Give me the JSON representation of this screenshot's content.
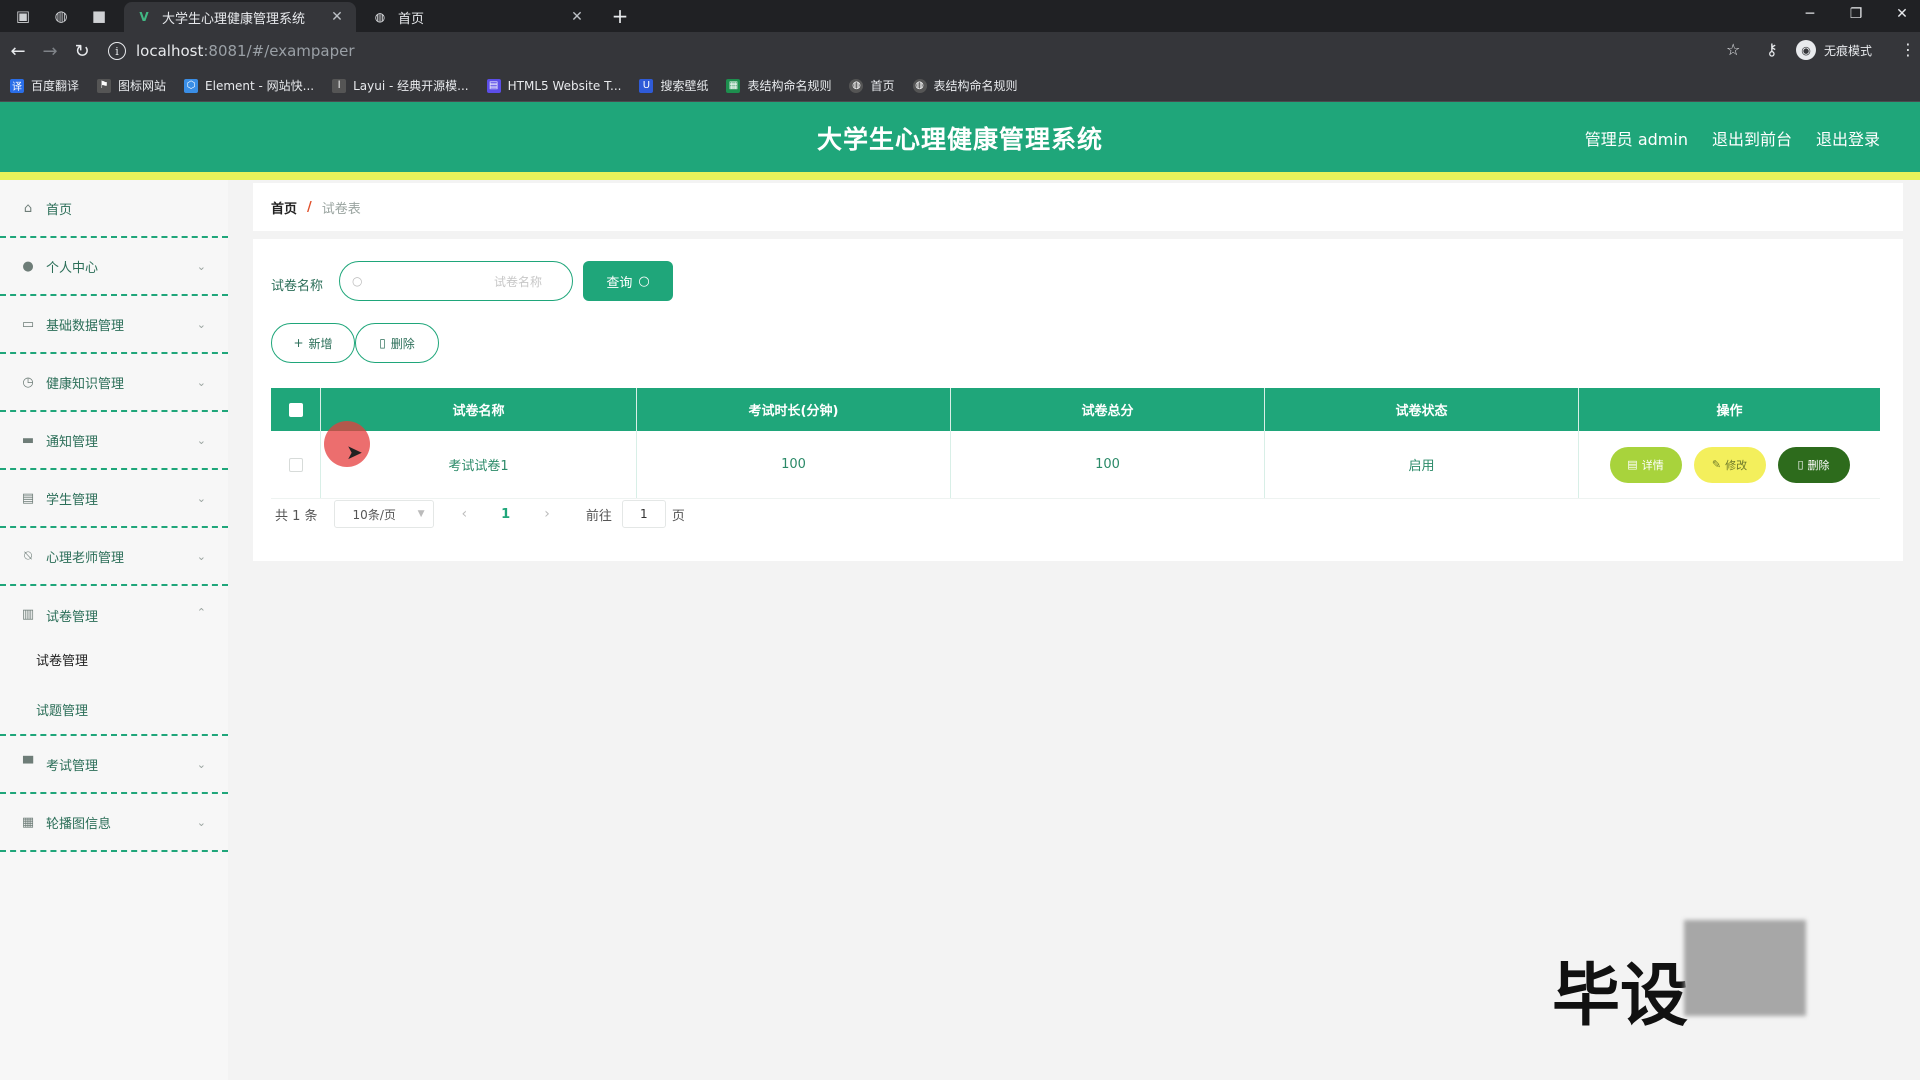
{
  "browser": {
    "tabs": [
      {
        "title": "大学生心理健康管理系统",
        "active": true
      },
      {
        "title": "首页",
        "active": false
      }
    ],
    "address": {
      "host": "localhost",
      "path": ":8081/#/exampaper"
    },
    "profile_label": "无痕模式",
    "bookmarks": [
      {
        "label": "百度翻译",
        "color": "#2a6ee8"
      },
      {
        "label": "图标网站",
        "color": "#444444"
      },
      {
        "label": "Element - 网站快...",
        "color": "#3a8ee6"
      },
      {
        "label": "Layui - 经典开源模...",
        "color": "#555555"
      },
      {
        "label": "HTML5 Website T...",
        "color": "#5c4ee8"
      },
      {
        "label": "搜索壁纸",
        "color": "#2f5bd8"
      },
      {
        "label": "表结构命名规则",
        "color": "#1d8f4e"
      },
      {
        "label": "首页",
        "color": "#444444"
      },
      {
        "label": "表结构命名规则",
        "color": "#444444"
      }
    ]
  },
  "header": {
    "title": "大学生心理健康管理系统",
    "user_label": "管理员 admin",
    "to_front_label": "退出到前台",
    "logout_label": "退出登录",
    "accent": "#1fa67a",
    "stripe": "#e7f35a"
  },
  "sidebar": {
    "items": [
      {
        "label": "首页",
        "icon": "home-icon"
      },
      {
        "label": "个人中心",
        "icon": "user-icon"
      },
      {
        "label": "基础数据管理",
        "icon": "chat-icon"
      },
      {
        "label": "健康知识管理",
        "icon": "clock-icon"
      },
      {
        "label": "通知管理",
        "icon": "briefcase-icon"
      },
      {
        "label": "学生管理",
        "icon": "message-icon"
      },
      {
        "label": "心理老师管理",
        "icon": "bell-off-icon"
      },
      {
        "label": "试卷管理",
        "icon": "clipboard-icon"
      },
      {
        "label": "考试管理",
        "icon": "monitor-icon"
      },
      {
        "label": "轮播图信息",
        "icon": "grid-icon"
      }
    ],
    "sub_items": [
      {
        "label": "试卷管理"
      },
      {
        "label": "试题管理"
      }
    ]
  },
  "breadcrumb": {
    "home": "首页",
    "separator": "/",
    "current": "试卷表"
  },
  "search": {
    "label": "试卷名称",
    "placeholder": "试卷名称",
    "button": "查询"
  },
  "actions": {
    "add": "新增",
    "delete": "删除"
  },
  "table": {
    "columns": [
      "试卷名称",
      "考试时长(分钟)",
      "试卷总分",
      "试卷状态",
      "操作"
    ],
    "rows": [
      {
        "name": "考试试卷1",
        "duration": "100",
        "score": "100",
        "status": "启用"
      }
    ],
    "row_actions": {
      "detail": "详情",
      "edit": "修改",
      "delete": "删除"
    }
  },
  "pagination": {
    "total": "共 1 条",
    "page_size": "10条/页",
    "current_page": "1",
    "goto_label": "前往",
    "goto_value": "1",
    "page_suffix": "页"
  },
  "watermark": {
    "text": "毕设"
  }
}
